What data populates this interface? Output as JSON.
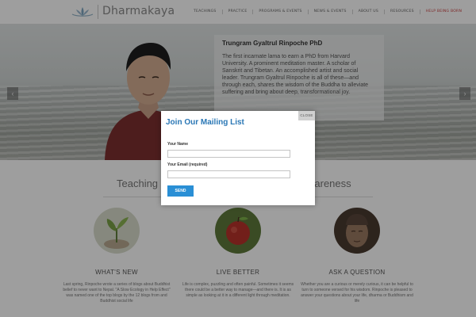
{
  "header": {
    "logo_text": "Dharmakaya",
    "nav": [
      {
        "label": "TEACHINGS"
      },
      {
        "label": "PRACTICE"
      },
      {
        "label": "PROGRAMS & EVENTS"
      },
      {
        "label": "NEWS & EVENTS"
      },
      {
        "label": "ABOUT US"
      },
      {
        "label": "RESOURCES"
      },
      {
        "label": "HELP BEING BORN"
      }
    ]
  },
  "hero": {
    "caption_title": "Trungram Gyaltrul Rinpoche PhD",
    "caption_body": "The first incarnate lama to earn a PhD from Harvard University. A prominent meditation master. A scholar of Sanskrit and Tibetan. An accomplished artist and social leader. Trungram Gyaltrul Rinpoche is all of these—and through each, shares the wisdom of the Buddha to alleviate suffering and bring about deep, transformational joy.",
    "arrow_left": "‹",
    "arrow_right": "›"
  },
  "section": {
    "title_left": "Teaching",
    "title_right": "wareness"
  },
  "features": [
    {
      "heading": "WHAT'S NEW",
      "body": "Last spring, Rinpoche wrote a series of blogs about Buddhist belief to never want to Nepal. \"A Slow Ecology in Help Effect\" was named one of the top blogs by the 12 blogs from and Buddhist social life"
    },
    {
      "heading": "LIVE BETTER",
      "body": "Life is complex, puzzling and often painful. Sometimes it seems there could be a better way to manage—and there is. It is as simple as looking at it in a different light through meditation."
    },
    {
      "heading": "ASK A QUESTION",
      "body": "Whether you are a curious or merely curious, it can be helpful to turn to someone versed for his wisdom. Rinpoche is pleased to answer your questions about your life, dharma or Buddhism and life"
    }
  ],
  "modal": {
    "close_label": "CLOSE",
    "title": "Join Our Mailing List",
    "name_label": "Your Name",
    "name_value": "",
    "email_label": "Your Email (required)",
    "email_value": "",
    "send_label": "SEND"
  },
  "colors": {
    "accent_blue": "#2a8fd5",
    "title_blue": "#2a77b5"
  }
}
